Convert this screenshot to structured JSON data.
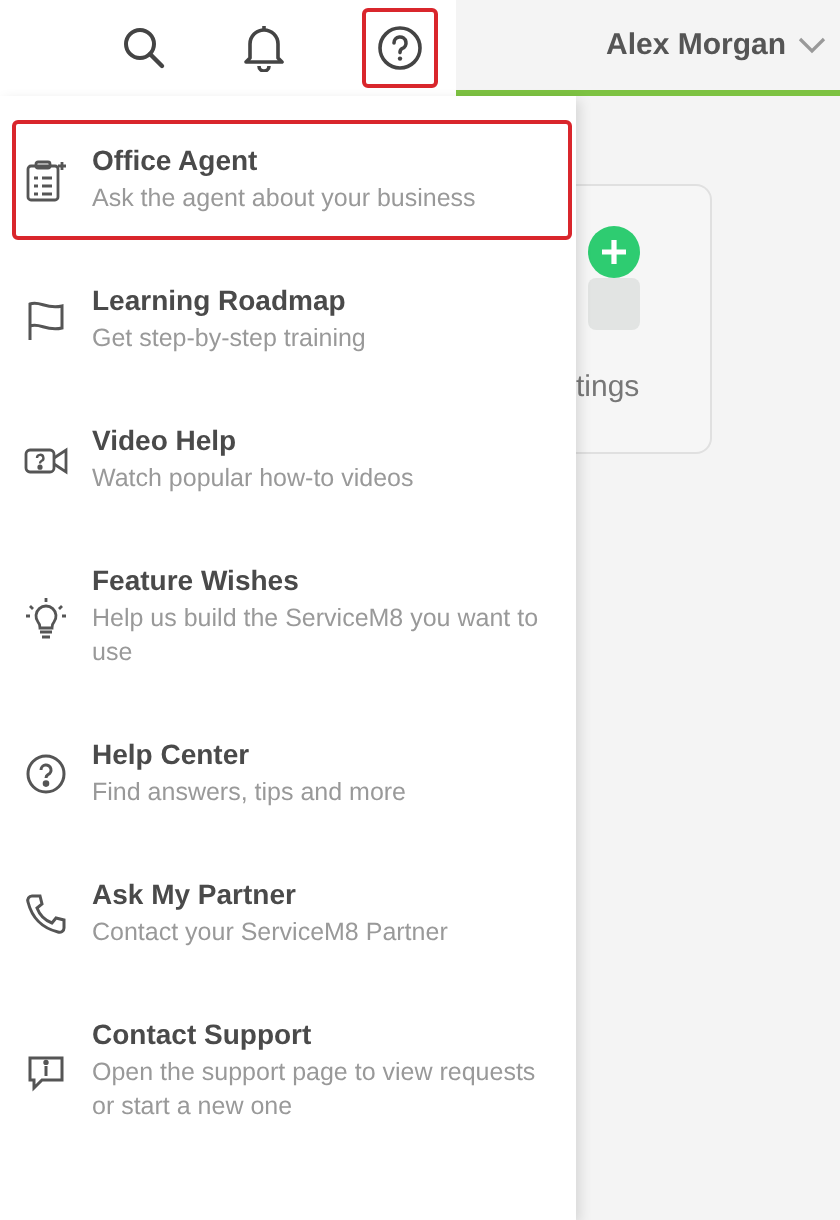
{
  "header": {
    "user_name": "Alex Morgan",
    "help_highlighted": true
  },
  "background_card": {
    "label": "tings"
  },
  "help_menu": {
    "items": [
      {
        "kind": "agent",
        "title": "Office Agent",
        "subtitle": "Ask the agent about your business",
        "highlighted": true
      },
      {
        "kind": "roadmap",
        "title": "Learning Roadmap",
        "subtitle": "Get step-by-step training",
        "highlighted": false
      },
      {
        "kind": "video",
        "title": "Video Help",
        "subtitle": "Watch popular how-to videos",
        "highlighted": false
      },
      {
        "kind": "wishes",
        "title": "Feature Wishes",
        "subtitle": "Help us build the ServiceM8 you want to use",
        "highlighted": false
      },
      {
        "kind": "help",
        "title": "Help Center",
        "subtitle": "Find answers, tips and more",
        "highlighted": false
      },
      {
        "kind": "partner",
        "title": "Ask My Partner",
        "subtitle": "Contact your ServiceM8 Partner",
        "highlighted": false
      },
      {
        "kind": "support",
        "title": "Contact Support",
        "subtitle": "Open the support page to view requests or start a new one",
        "highlighted": false
      }
    ]
  }
}
